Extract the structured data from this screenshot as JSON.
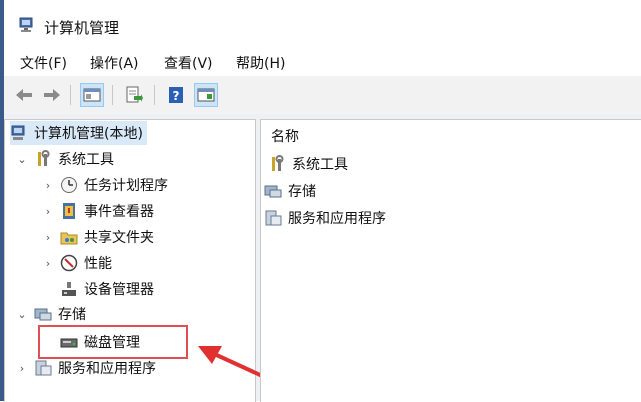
{
  "window": {
    "title": "计算机管理"
  },
  "menu": [
    {
      "label": "文件(F)"
    },
    {
      "label": "操作(A)"
    },
    {
      "label": "查看(V)"
    },
    {
      "label": "帮助(H)"
    }
  ],
  "tree": {
    "root": "计算机管理(本地)",
    "system_tools": "系统工具",
    "task_scheduler": "任务计划程序",
    "event_viewer": "事件查看器",
    "shared_folders": "共享文件夹",
    "performance": "性能",
    "device_manager": "设备管理器",
    "storage": "存储",
    "disk_management": "磁盘管理",
    "services_apps": "服务和应用程序"
  },
  "content": {
    "column_name": "名称",
    "items": [
      {
        "label": "系统工具"
      },
      {
        "label": "存储"
      },
      {
        "label": "服务和应用程序"
      }
    ]
  },
  "colors": {
    "highlight_box": "#e05050",
    "selection": "#d9e9f8",
    "accent": "#3a5a8a"
  }
}
